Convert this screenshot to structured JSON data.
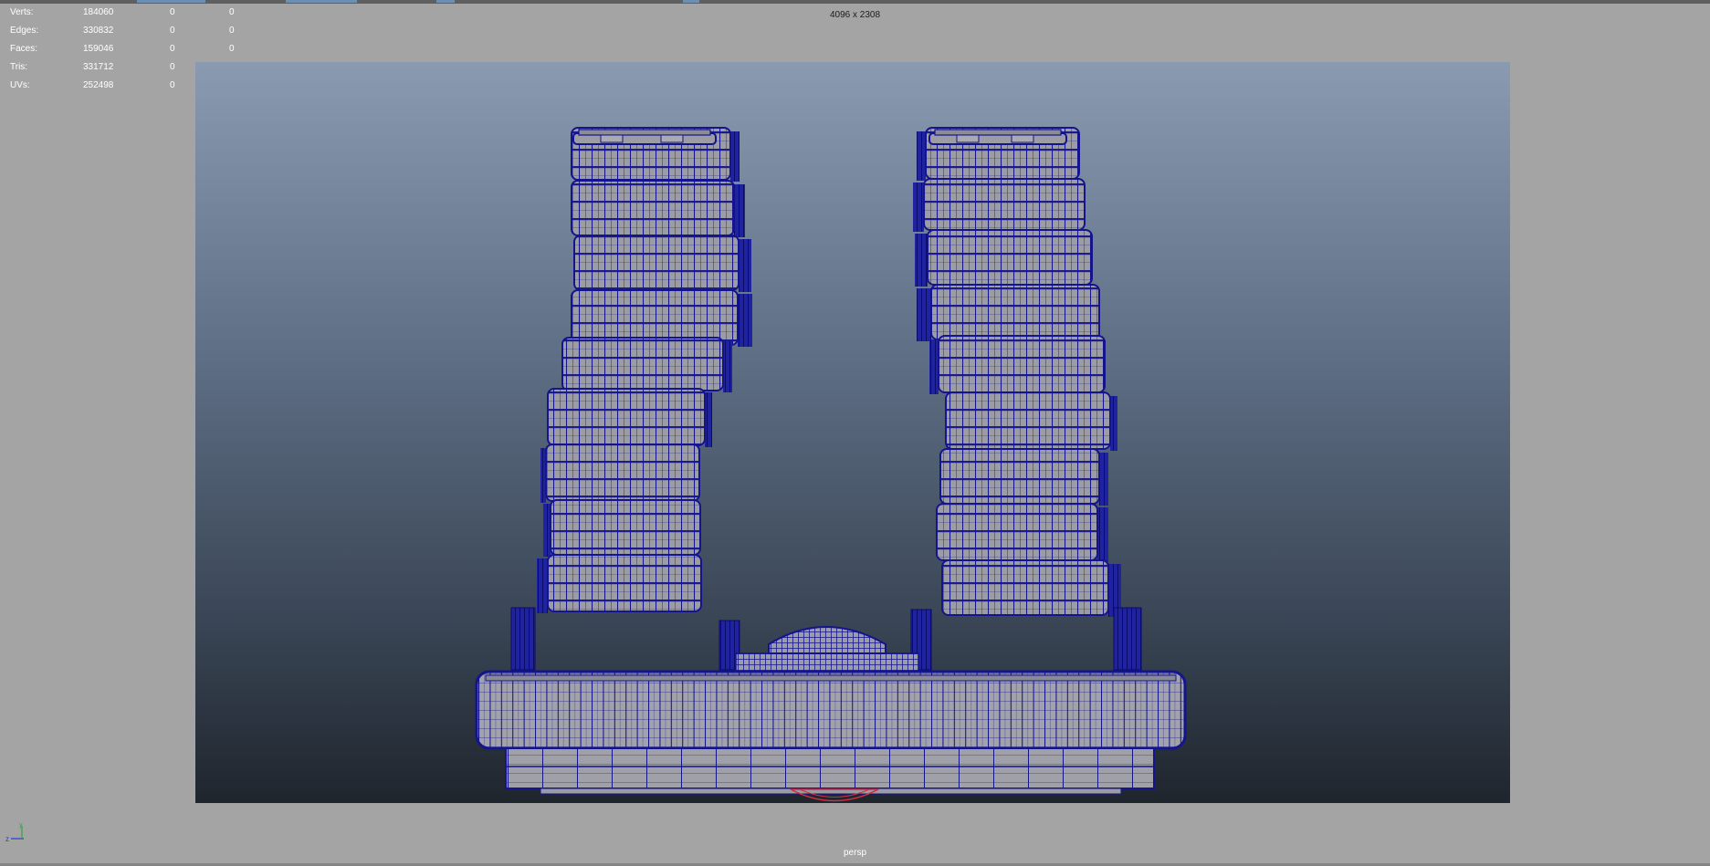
{
  "viewport": {
    "resolution_label": "4096 x 2308",
    "camera_label": "persp",
    "background_top": "#8a9ab1",
    "background_bottom": "#1f252d"
  },
  "hud": {
    "rows": [
      {
        "label": "Verts:",
        "v1": "184060",
        "v2": "0",
        "v3": "0"
      },
      {
        "label": "Edges:",
        "v1": "330832",
        "v2": "0",
        "v3": "0"
      },
      {
        "label": "Faces:",
        "v1": "159046",
        "v2": "0",
        "v3": "0"
      },
      {
        "label": "Tris:",
        "v1": "331712",
        "v2": "0",
        "v3": "0"
      },
      {
        "label": "UVs:",
        "v1": "252498",
        "v2": "0",
        "v3": "0"
      }
    ]
  },
  "axis_gizmo": {
    "x_label": "z",
    "y_label": "y",
    "icon": "axis-gizmo-icon"
  },
  "model": {
    "fill": "#9c9ca4",
    "wire_color": "#14148c",
    "selection_color": "#d03040"
  }
}
